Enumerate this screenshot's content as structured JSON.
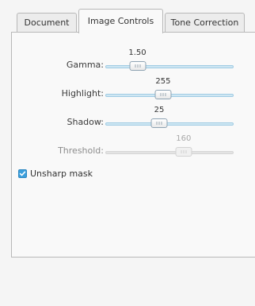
{
  "tabs": [
    {
      "label": "Document",
      "active": false
    },
    {
      "label": "Image Controls",
      "active": true
    },
    {
      "label": "Tone Correction",
      "active": false
    }
  ],
  "sliders": {
    "gamma": {
      "label": "Gamma:",
      "value": "1.50",
      "level": 0.25,
      "enabled": true
    },
    "highlight": {
      "label": "Highlight:",
      "value": "255",
      "level": 0.45,
      "enabled": true
    },
    "shadow": {
      "label": "Shadow:",
      "value": "25",
      "level": 0.42,
      "enabled": true
    },
    "threshold": {
      "label": "Threshold:",
      "value": "160",
      "level": 0.61,
      "enabled": false
    }
  },
  "unsharp_mask": {
    "label": "Unsharp mask",
    "checked": true
  },
  "colors": {
    "accent": "#3b9fdc",
    "track": "#cfe7f3",
    "disabled": "#e3e3e3"
  },
  "icons": {
    "checkbox": "check-icon",
    "thumb": "grip-icon"
  }
}
